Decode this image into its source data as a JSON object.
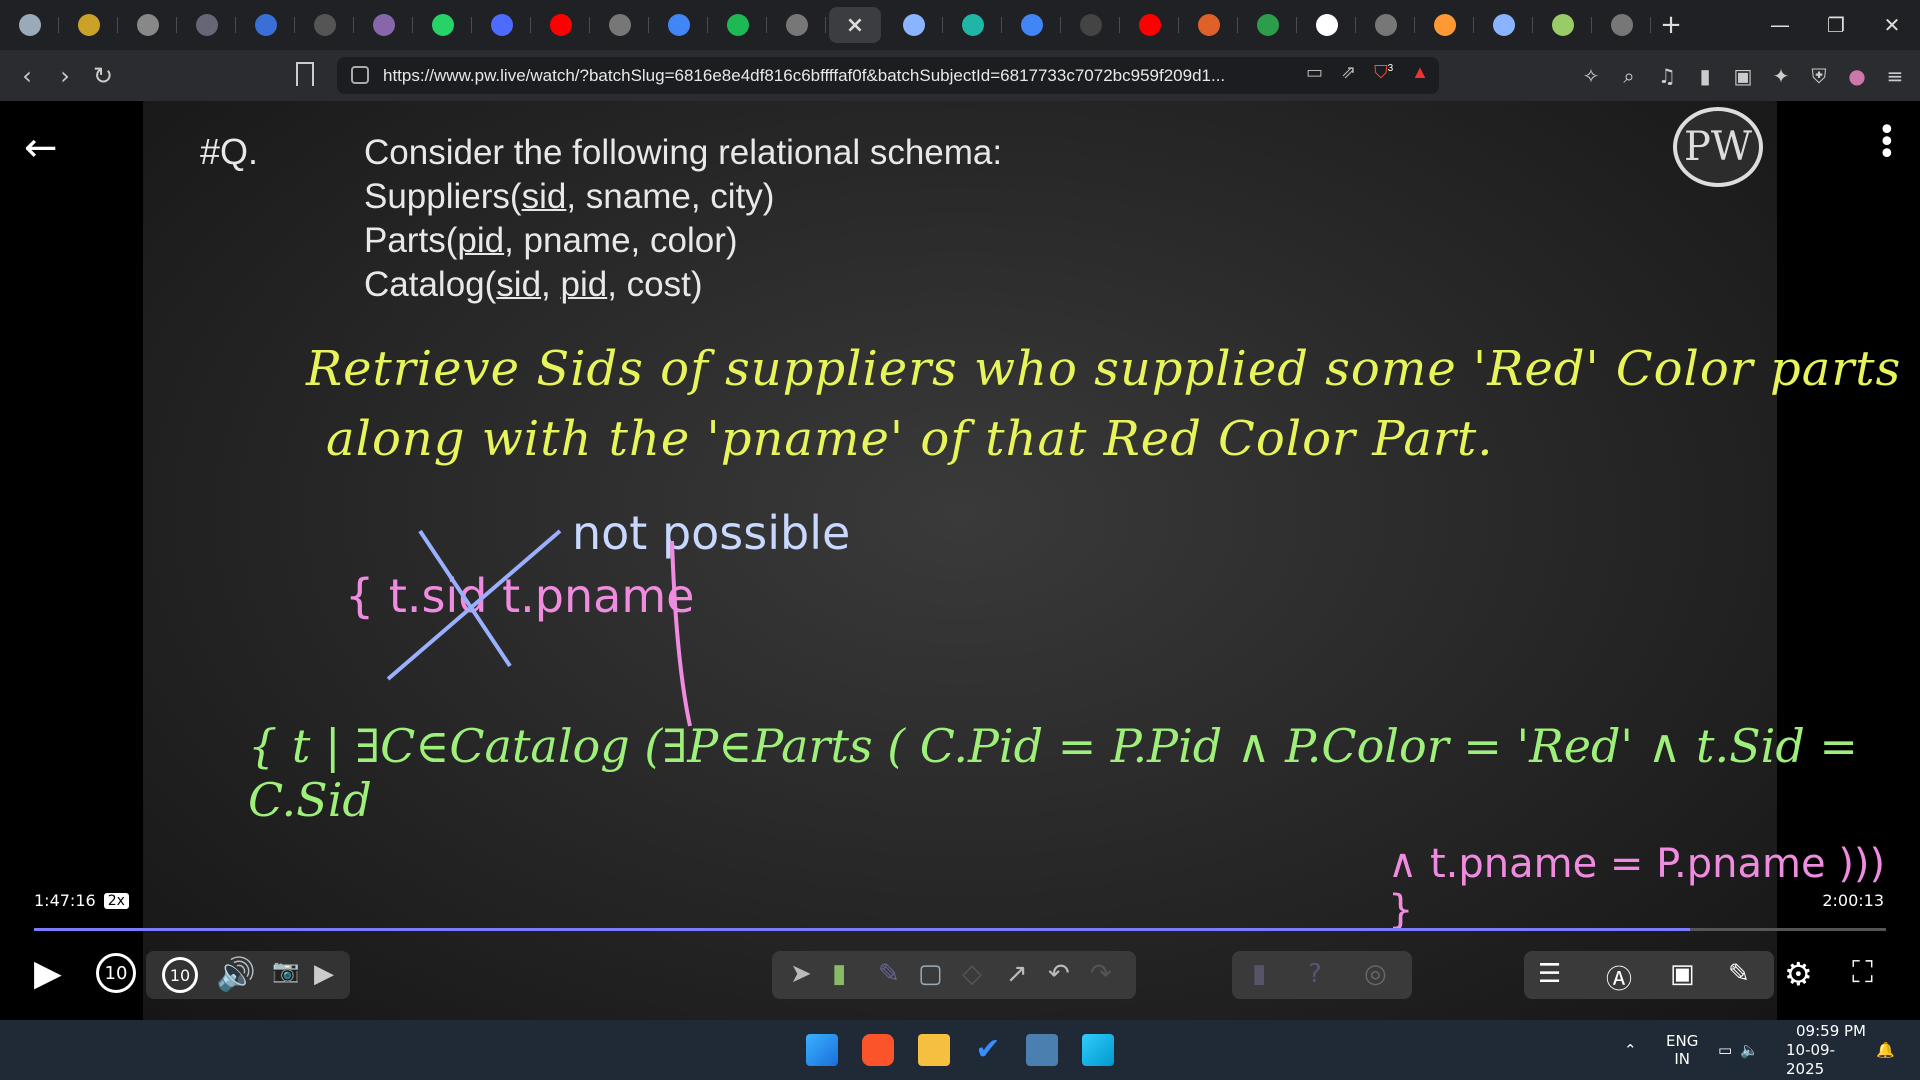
{
  "browser": {
    "tab_count_icons": [
      "chat-icon",
      "coin-icon",
      "globe-icon",
      "globe-icon",
      "w3-icon",
      "globe-icon",
      "globe-icon",
      "whatsapp-icon",
      "bookmark-icon",
      "youtube-icon",
      "globe-icon",
      "google-icon",
      "spotify-icon",
      "globe-icon",
      "close-icon",
      "gemini-icon",
      "app-icon",
      "google-icon",
      "screen-icon",
      "youtube-icon",
      "globe-icon",
      "leetcode-icon",
      "wikipedia-icon",
      "globe-icon",
      "india-flag-icon",
      "gemini-icon",
      "g-icon",
      "globe-icon"
    ],
    "active_tab_close": "×",
    "new_tab": "+",
    "url": "https://www.pw.live/watch/?batchSlug=6816e8e4df816c6bffffaf0f&batchSubjectId=6817733c7072bc959f209d1...",
    "shield_count": "3"
  },
  "slide": {
    "question_label": "#Q.",
    "schema_intro": "Consider the following relational schema:",
    "suppliers": {
      "name": "Suppliers(",
      "key": "sid",
      "rest": ", sname, city)"
    },
    "parts": {
      "name": "Parts(",
      "key": "pid",
      "rest": ", pname, color)"
    },
    "catalog": {
      "name": "Catalog(",
      "key1": "sid",
      "sep": ", ",
      "key2": "pid",
      "rest": ", cost)"
    },
    "problem_line1": "Retrieve Sids of suppliers who supplied some 'Red' Color parts",
    "problem_line2": "along with the 'pname' of that Red Color Part.",
    "attempt": "{ t.sid  t.pname",
    "not_possible": "not possible",
    "query_line1": "{ t | ∃C∈Catalog (∃P∈Parts ( C.Pid = P.Pid ∧ P.Color = 'Red' ∧ t.Sid = C.Sid",
    "query_line2": "∧ t.pname = P.pname ))) }",
    "logo": "PW"
  },
  "player": {
    "current_time": "1:47:16",
    "speed": "2x",
    "total_time": "2:00:13",
    "progress": 0.894,
    "skip_back": "10",
    "skip_forward": "10"
  },
  "taskbar": {
    "lang_top": "ENG",
    "lang_bottom": "IN",
    "time": "09:59 PM",
    "date": "10-09-2025"
  }
}
